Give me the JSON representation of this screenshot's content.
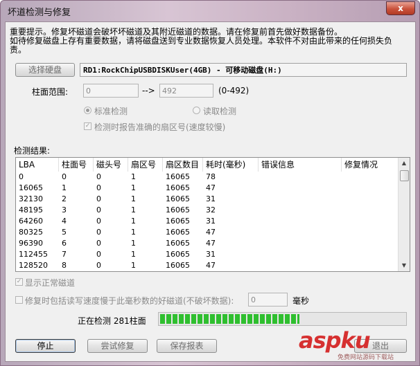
{
  "window": {
    "title": "坏道检测与修复",
    "close_label": "x"
  },
  "notice": {
    "line1": "重要提示。修复坏磁道会破坏坏磁道及其附近磁道的数据。请在修复前首先做好数据备份。",
    "line2": "如待修复磁盘上存有重要数据，请将磁盘送到专业数据恢复人员处理。本软件不对由此带来的任何损失负",
    "line3": "责。"
  },
  "disk": {
    "select_button": "选择硬盘",
    "name": "RD1:RockChipUSBDISKUser(4GB) - 可移动磁盘(H:)"
  },
  "cylinder": {
    "label": "柱面范围:",
    "from": "0",
    "arrow": "-->",
    "to": "492",
    "range": "(0-492)"
  },
  "mode": {
    "standard": "标准检测",
    "read": "读取检测",
    "report_sector": "检测时报告准确的扇区号(速度较慢)",
    "selected": "standard"
  },
  "results": {
    "label": "检测结果:",
    "columns": [
      "LBA",
      "柱面号",
      "磁头号",
      "扇区号",
      "扇区数目",
      "耗时(毫秒)",
      "错误信息",
      "修复情况"
    ],
    "rows": [
      [
        "0",
        "0",
        "0",
        "1",
        "16065",
        "78",
        "",
        ""
      ],
      [
        "16065",
        "1",
        "0",
        "1",
        "16065",
        "47",
        "",
        ""
      ],
      [
        "32130",
        "2",
        "0",
        "1",
        "16065",
        "31",
        "",
        ""
      ],
      [
        "48195",
        "3",
        "0",
        "1",
        "16065",
        "32",
        "",
        ""
      ],
      [
        "64260",
        "4",
        "0",
        "1",
        "16065",
        "31",
        "",
        ""
      ],
      [
        "80325",
        "5",
        "0",
        "1",
        "16065",
        "47",
        "",
        ""
      ],
      [
        "96390",
        "6",
        "0",
        "1",
        "16065",
        "47",
        "",
        ""
      ],
      [
        "112455",
        "7",
        "0",
        "1",
        "16065",
        "31",
        "",
        ""
      ],
      [
        "128520",
        "8",
        "0",
        "1",
        "16065",
        "47",
        "",
        ""
      ]
    ]
  },
  "options": {
    "show_normal": "显示正常磁道",
    "repair_slow": "修复时包括读写速度慢于此毫秒数的好磁道(不破坏数据):",
    "ms_value": "0",
    "ms_unit": "毫秒"
  },
  "status": {
    "text": "正在检测 281柱面",
    "progress_fraction": 0.57
  },
  "buttons": {
    "stop": "停止",
    "try_repair": "尝试修复",
    "save_report": "保存报表",
    "exit": "退出"
  },
  "watermark": {
    "logo": "aspku",
    "sub": "免费网站源码下载站"
  }
}
